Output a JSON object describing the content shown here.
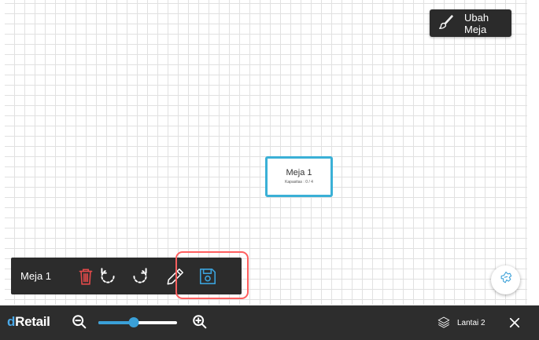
{
  "header": {
    "edit_table_label": "Ubah Meja"
  },
  "table": {
    "name": "Meja 1",
    "capacity": "Kapasitas : 0 / 4"
  },
  "toolbar": {
    "table_label": "Meja 1",
    "icons": [
      "trash-icon",
      "rotate-left-icon",
      "rotate-right-icon",
      "pencil-icon",
      "save-icon"
    ]
  },
  "bottom_bar": {
    "logo_part1": "d",
    "logo_part2": "Retail",
    "zoom_level": 0.45,
    "floor_label": "Lantai 2"
  },
  "colors": {
    "accent": "#3aa0d8",
    "table_border": "#3ab0d6",
    "trash": "#e24a4a",
    "highlight": "#ff5f5f",
    "dark_bar": "#2d2d2d"
  }
}
